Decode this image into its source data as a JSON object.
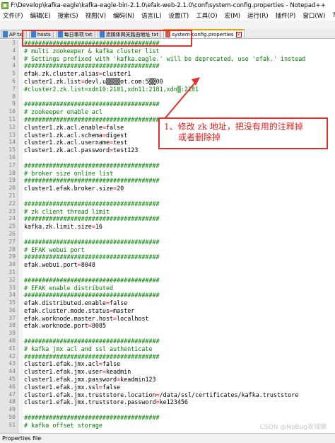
{
  "window": {
    "title": "F:\\Develop\\kafka-eagle\\kafka-eagle-bin-2.1.0\\efak-web-2.1.0\\conf\\system-config.properties - Notepad++"
  },
  "menu": [
    "文件(F)",
    "编辑(E)",
    "搜索(S)",
    "视图(V)",
    "编码(N)",
    "语言(L)",
    "设置(T)",
    "工具(O)",
    "宏(M)",
    "运行(R)",
    "插件(P)",
    "窗口(W)",
    "?"
  ],
  "tabs": [
    {
      "label": "AP txt",
      "active": false,
      "icon": "file-icon"
    },
    {
      "label": "hosts",
      "active": false,
      "icon": "file-icon"
    },
    {
      "label": "每日事项 txt",
      "active": false,
      "icon": "file-icon"
    },
    {
      "label": "流媒体网关路由地址 txt",
      "active": false,
      "icon": "file-icon"
    },
    {
      "label": "system-config.properties",
      "active": true,
      "icon": "file-icon"
    }
  ],
  "lines": [
    {
      "n": "3",
      "type": "comment",
      "text": "######################################"
    },
    {
      "n": "4",
      "type": "comment",
      "text": "# multi zookeeper & kafka cluster list"
    },
    {
      "n": "4",
      "type": "comment",
      "text": "# Settings prefixed with 'kafka.eagle.' will be deprecated, use 'efak.' instead"
    },
    {
      "n": "4",
      "type": "comment",
      "text": "######################################"
    },
    {
      "n": "5",
      "type": "kv",
      "key": "efak.zk.cluster.alias",
      "value": "cluster1"
    },
    {
      "n": "6",
      "type": "kv",
      "key": "cluster1.zk.list",
      "value": "devl.u▒▒▒▒ot.com:5▒▒00"
    },
    {
      "n": "7",
      "type": "comment",
      "text": "#cluster2.zk.list=xdn10:2181,xdn11:2181,xdn▒:2181"
    },
    {
      "n": "8",
      "type": "blank",
      "text": ""
    },
    {
      "n": "9",
      "type": "comment",
      "text": "######################################"
    },
    {
      "n": "10",
      "type": "comment",
      "text": "# zookeeper enable acl"
    },
    {
      "n": "11",
      "type": "comment",
      "text": "######################################"
    },
    {
      "n": "12",
      "type": "kv",
      "key": "cluster1.zk.acl.enable",
      "value": "false"
    },
    {
      "n": "13",
      "type": "kv",
      "key": "cluster1.zk.acl.schema",
      "value": "digest"
    },
    {
      "n": "14",
      "type": "kv",
      "key": "cluster1.zk.acl.username",
      "value": "test"
    },
    {
      "n": "15",
      "type": "kv",
      "key": "cluster1.zk.acl.password",
      "value": "test123"
    },
    {
      "n": "16",
      "type": "blank",
      "text": ""
    },
    {
      "n": "17",
      "type": "comment",
      "text": "######################################"
    },
    {
      "n": "18",
      "type": "comment",
      "text": "# broker size online list"
    },
    {
      "n": "19",
      "type": "comment",
      "text": "######################################"
    },
    {
      "n": "20",
      "type": "kv",
      "key": "cluster1.efak.broker.size",
      "value": "20"
    },
    {
      "n": "21",
      "type": "blank",
      "text": ""
    },
    {
      "n": "22",
      "type": "comment",
      "text": "######################################"
    },
    {
      "n": "23",
      "type": "comment",
      "text": "# zk client thread limit"
    },
    {
      "n": "24",
      "type": "comment",
      "text": "######################################"
    },
    {
      "n": "25",
      "type": "kv",
      "key": "kafka.zk.limit.size",
      "value": "16"
    },
    {
      "n": "26",
      "type": "blank",
      "text": ""
    },
    {
      "n": "27",
      "type": "comment",
      "text": "######################################"
    },
    {
      "n": "28",
      "type": "comment",
      "text": "# EFAK webui port"
    },
    {
      "n": "29",
      "type": "comment",
      "text": "######################################"
    },
    {
      "n": "30",
      "type": "kv",
      "key": "efak.webui.port",
      "value": "8048"
    },
    {
      "n": "31",
      "type": "blank",
      "text": ""
    },
    {
      "n": "32",
      "type": "comment",
      "text": "######################################"
    },
    {
      "n": "33",
      "type": "comment",
      "text": "# EFAK enable distributed"
    },
    {
      "n": "34",
      "type": "comment",
      "text": "######################################"
    },
    {
      "n": "35",
      "type": "kv",
      "key": "efak.distributed.enable",
      "value": "false"
    },
    {
      "n": "36",
      "type": "kv",
      "key": "efak.cluster.mode.status",
      "value": "master"
    },
    {
      "n": "37",
      "type": "kv",
      "key": "efak.worknode.master.host",
      "value": "localhost"
    },
    {
      "n": "38",
      "type": "kv",
      "key": "efak.worknode.port",
      "value": "8085"
    },
    {
      "n": "39",
      "type": "blank",
      "text": ""
    },
    {
      "n": "40",
      "type": "comment",
      "text": "######################################"
    },
    {
      "n": "41",
      "type": "comment",
      "text": "# kafka jmx acl and ssl authenticate"
    },
    {
      "n": "42",
      "type": "comment",
      "text": "######################################"
    },
    {
      "n": "43",
      "type": "kv",
      "key": "cluster1.efak.jmx.acl",
      "value": "false"
    },
    {
      "n": "44",
      "type": "kv",
      "key": "cluster1.efak.jmx.user",
      "value": "keadmin"
    },
    {
      "n": "45",
      "type": "kv",
      "key": "cluster1.efak.jmx.password",
      "value": "keadmin123"
    },
    {
      "n": "46",
      "type": "kv",
      "key": "cluster1.efak.jmx.ssl",
      "value": "false"
    },
    {
      "n": "47",
      "type": "kv",
      "key": "cluster1.efak.jmx.truststore.location",
      "value": "/data/ssl/certificates/kafka.truststore"
    },
    {
      "n": "48",
      "type": "kv",
      "key": "cluster1.efak.jmx.truststore.password",
      "value": "ke123456"
    },
    {
      "n": "49",
      "type": "blank",
      "text": ""
    },
    {
      "n": "50",
      "type": "comment",
      "text": "######################################"
    },
    {
      "n": "51",
      "type": "comment",
      "text": "# kafka offset storage"
    }
  ],
  "annotation": {
    "line1": "1、修改 zk 地址，把没有用的注释掉",
    "line2": "或者删除掉",
    "color": "#e02020"
  },
  "statusbar": {
    "text": "Properties file"
  },
  "watermark": "CSDN @NoBug攻城狮"
}
